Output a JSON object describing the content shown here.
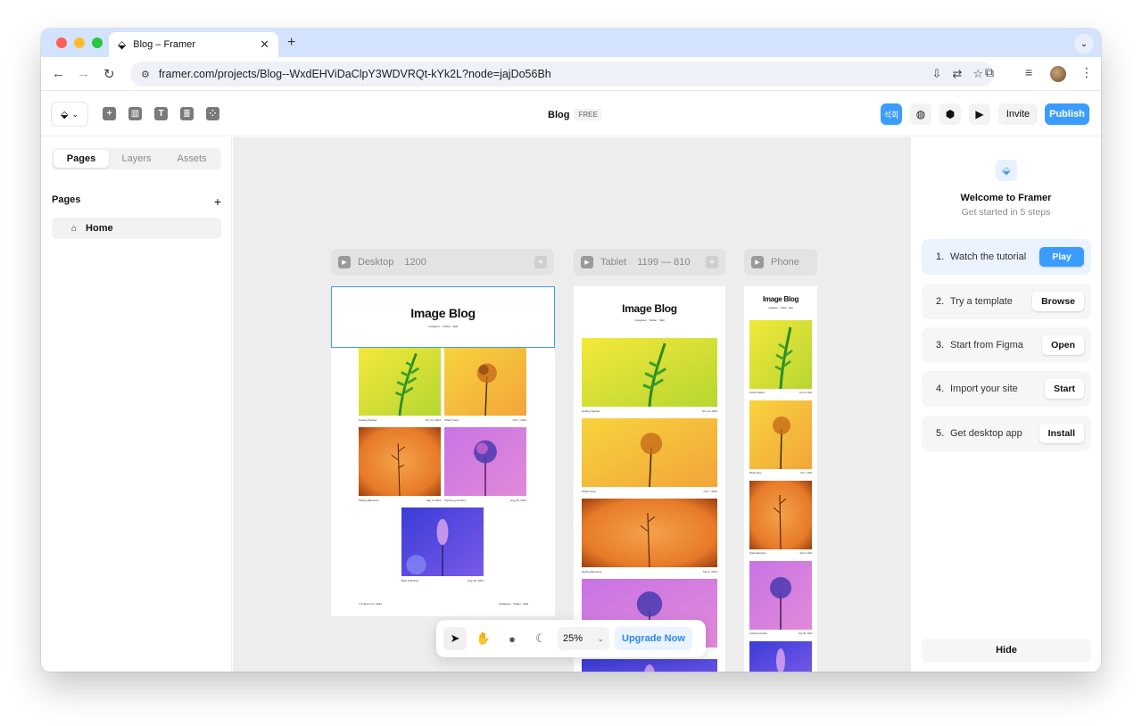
{
  "browser": {
    "tab_title": "Blog – Framer",
    "url": "framer.com/projects/Blog--WxdEHViDaClpY3WDVRQt-kYk2L?node=jajDo56Bh"
  },
  "toolbar": {
    "project_name": "Blog",
    "plan_badge": "FREE",
    "lang_label": "석회",
    "invite_label": "Invite",
    "publish_label": "Publish"
  },
  "left_panel": {
    "tabs": [
      "Pages",
      "Layers",
      "Assets"
    ],
    "active_tab": "Pages",
    "section_title": "Pages",
    "pages": [
      {
        "label": "Home"
      }
    ]
  },
  "canvas": {
    "frames": [
      {
        "label": "Desktop",
        "dims": "1200"
      },
      {
        "label": "Tablet",
        "dims": "1199 — 810"
      },
      {
        "label": "Phone",
        "dims": ""
      }
    ],
    "blog_title": "Image Blog",
    "blog_links": "Instagram · Twitter · Mail",
    "posts": [
      {
        "title": "Getting Started",
        "date": "Oct 14, 2024"
      },
      {
        "title": "What's New",
        "date": "Oct 7, 2024"
      },
      {
        "title": "Styling Elements",
        "date": "Sep 9, 2024"
      },
      {
        "title": "Importing Content",
        "date": "Aug 30, 2024"
      },
      {
        "title": "Best Practices",
        "date": "Aug 18, 2024"
      }
    ],
    "footer_left": "© Framer Inc. 2024",
    "footer_right": "Instagram · Twitter · Mail"
  },
  "floating_toolbar": {
    "zoom": "25%",
    "upgrade_label": "Upgrade Now"
  },
  "right_panel": {
    "title": "Welcome to Framer",
    "subtitle": "Get started in 5 steps",
    "steps": [
      {
        "num": "1.",
        "label": "Watch the tutorial",
        "button": "Play"
      },
      {
        "num": "2.",
        "label": "Try a template",
        "button": "Browse"
      },
      {
        "num": "3.",
        "label": "Start from Figma",
        "button": "Open"
      },
      {
        "num": "4.",
        "label": "Import your site",
        "button": "Start"
      },
      {
        "num": "5.",
        "label": "Get desktop app",
        "button": "Install"
      }
    ],
    "hide_label": "Hide"
  },
  "colors": {
    "accent": "#3b9cff",
    "canvas_bg": "#ededed",
    "tabstrip_bg": "#d3e3fd"
  }
}
